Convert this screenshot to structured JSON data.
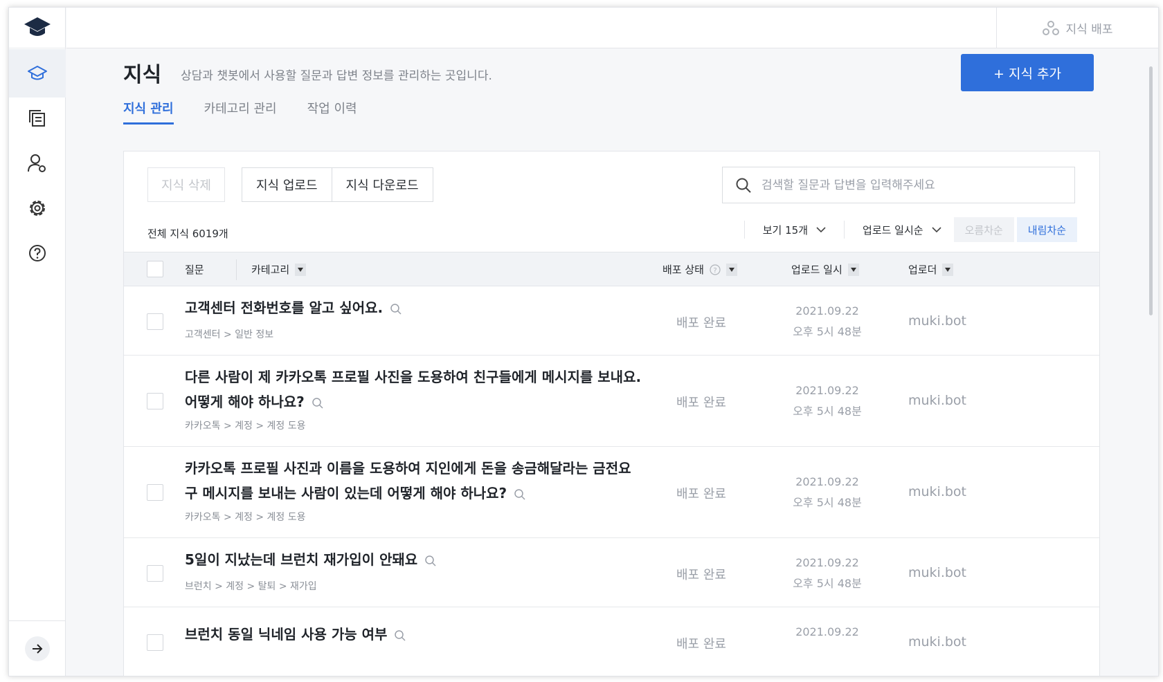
{
  "header": {
    "title": "지식",
    "description": "상담과 챗봇에서 사용할 질문과 답변 정보를 관리하는 곳입니다.",
    "add_button": "+ 지식 추가",
    "deploy_label": "지식 배포"
  },
  "tabs": [
    {
      "label": "지식 관리",
      "active": true
    },
    {
      "label": "카테고리 관리",
      "active": false
    },
    {
      "label": "작업 이력",
      "active": false
    }
  ],
  "toolbar": {
    "delete_label": "지식 삭제",
    "upload_label": "지식 업로드",
    "download_label": "지식 다운로드",
    "search_placeholder": "검색할 질문과 답변을 입력해주세요",
    "total_label": "전체 지식 6019개",
    "view_count": "보기 15개",
    "sort_field": "업로드 일시순",
    "asc_label": "오름차순",
    "desc_label": "내림차순"
  },
  "table": {
    "columns": {
      "question": "질문",
      "category": "카테고리",
      "status": "배포 상태",
      "uploaded_at": "업로드 일시",
      "uploader": "업로더"
    },
    "rows": [
      {
        "question": "고객센터 전화번호를 알고 싶어요.",
        "category": "고객센터 > 일반 정보",
        "status": "배포 완료",
        "date": "2021.09.22",
        "time": "오후 5시 48분",
        "uploader": "muki.bot"
      },
      {
        "question": "다른 사람이 제 카카오톡 프로필 사진을 도용하여 친구들에게 메시지를 보내요. 어떻게 해야 하나요?",
        "category": "카카오톡 > 계정 > 계정 도용",
        "status": "배포 완료",
        "date": "2021.09.22",
        "time": "오후 5시 48분",
        "uploader": "muki.bot"
      },
      {
        "question": "카카오톡 프로필 사진과 이름을 도용하여 지인에게 돈을 송금해달라는 금전요구 메시지를 보내는 사람이 있는데 어떻게 해야 하나요?",
        "category": "카카오톡 > 계정 > 계정 도용",
        "status": "배포 완료",
        "date": "2021.09.22",
        "time": "오후 5시 48분",
        "uploader": "muki.bot"
      },
      {
        "question": "5일이 지났는데 브런치 재가입이 안돼요",
        "category": "브런치 > 계정 > 탈퇴 > 재가입",
        "status": "배포 완료",
        "date": "2021.09.22",
        "time": "오후 5시 48분",
        "uploader": "muki.bot"
      },
      {
        "question": "브런치 동일 닉네임 사용 가능 여부",
        "category": "",
        "status": "배포 완료",
        "date": "2021.09.22",
        "time": "",
        "uploader": "muki.bot"
      }
    ]
  },
  "colors": {
    "accent": "#2f6fdb",
    "muted": "#9a9fa8"
  },
  "icons": [
    "graduation-cap-logo-icon",
    "knowledge-icon",
    "documents-icon",
    "user-settings-icon",
    "gear-icon",
    "help-icon",
    "arrow-right-icon",
    "deploy-icon",
    "search-icon",
    "dropdown-icon",
    "chevron-down-icon",
    "magnifier-icon"
  ]
}
